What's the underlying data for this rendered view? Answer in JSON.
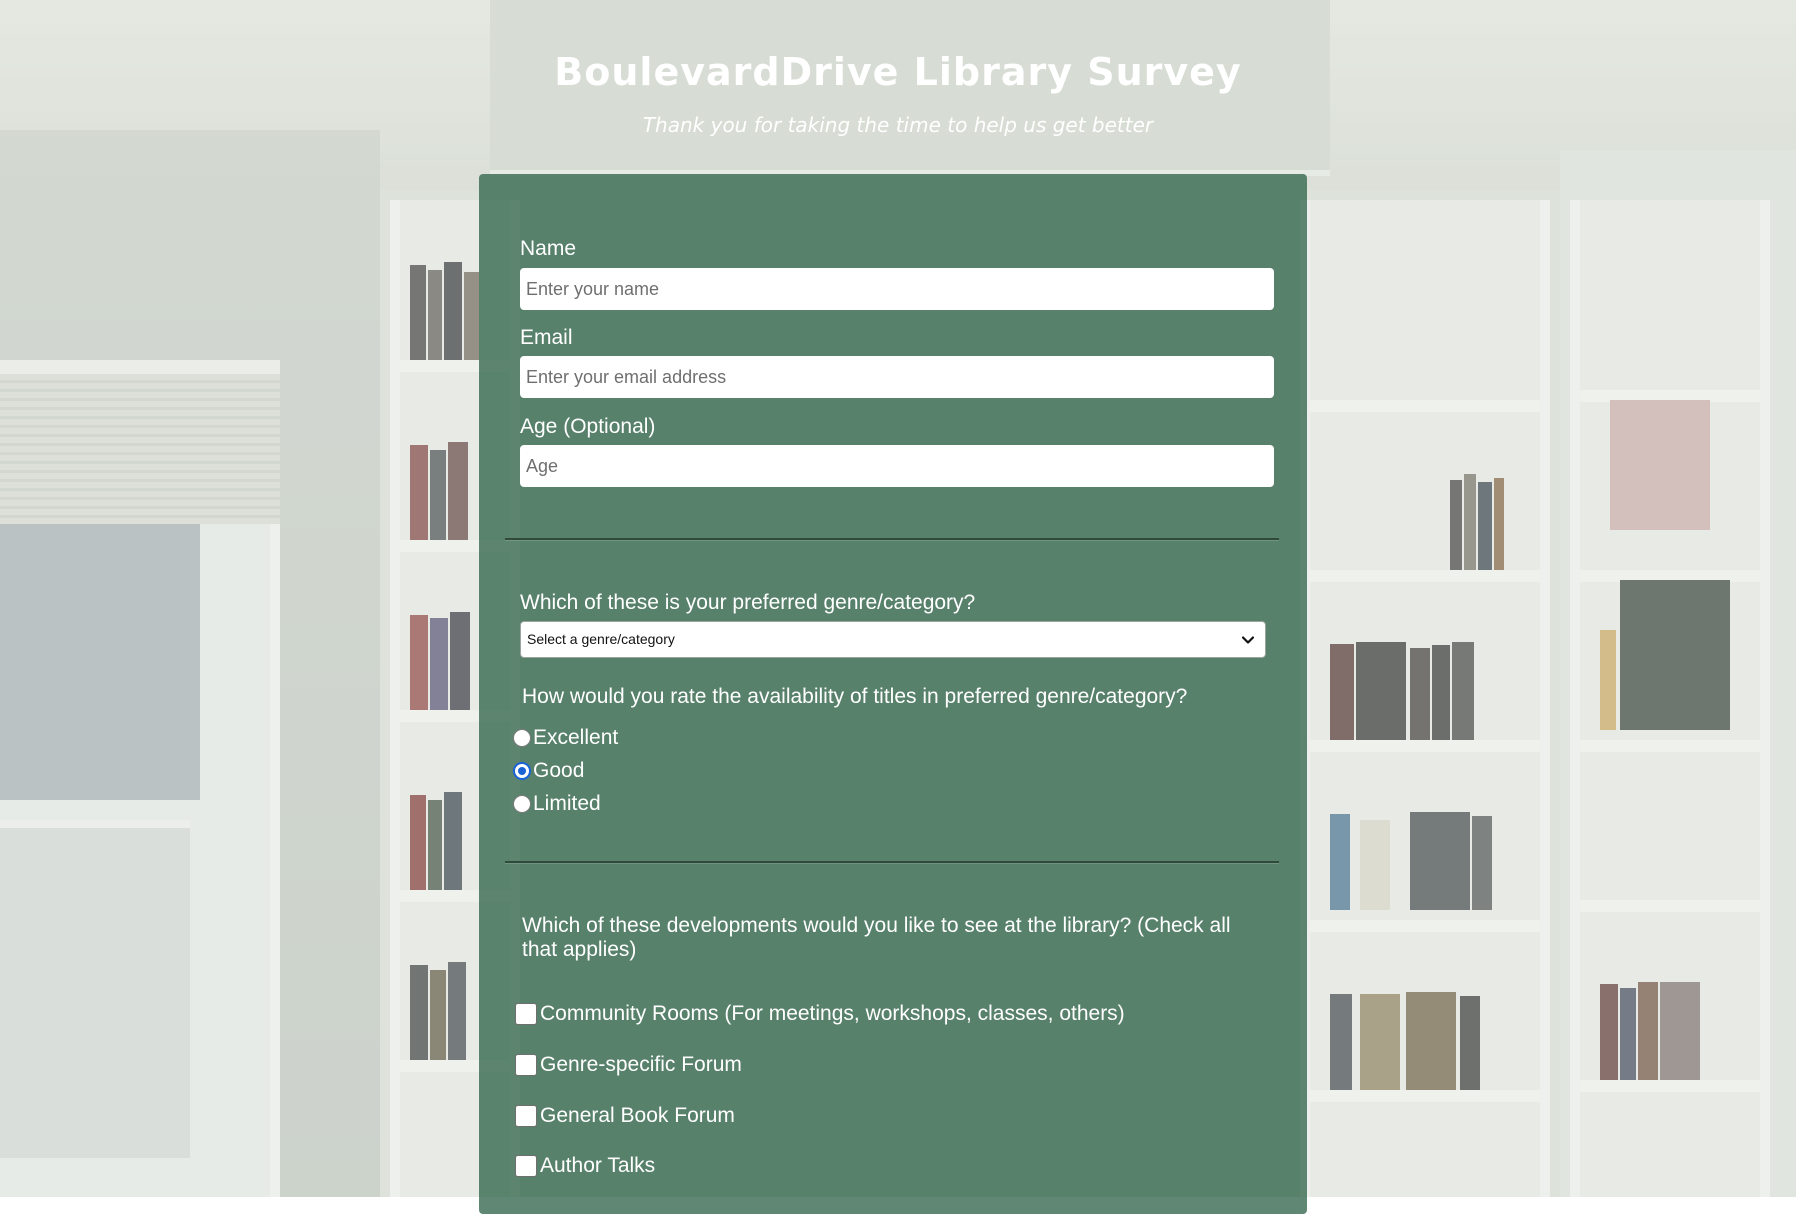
{
  "header": {
    "title": "BoulevardDrive Library Survey",
    "subtitle": "Thank you for taking the time to help us get better"
  },
  "form": {
    "name": {
      "label": "Name",
      "placeholder": "Enter your name",
      "value": ""
    },
    "email": {
      "label": "Email",
      "placeholder": "Enter your email address",
      "value": ""
    },
    "age": {
      "label": "Age (Optional)",
      "placeholder": "Age",
      "value": ""
    },
    "genre": {
      "question": "Which of these is your preferred genre/category?",
      "selected": "Select a genre/category"
    },
    "availability": {
      "question": "How would you rate the availability of titles in preferred genre/category?",
      "options": [
        {
          "label": "Excellent",
          "checked": false
        },
        {
          "label": "Good",
          "checked": true
        },
        {
          "label": "Limited",
          "checked": false
        }
      ]
    },
    "developments": {
      "question": "Which of these developments would you like to see at the library? (Check all that applies)",
      "options": [
        {
          "label": "Community Rooms (For meetings, workshops, classes, others)",
          "checked": false
        },
        {
          "label": "Genre-specific Forum",
          "checked": false
        },
        {
          "label": "General Book Forum",
          "checked": false
        },
        {
          "label": "Author Talks",
          "checked": false
        }
      ]
    }
  },
  "colors": {
    "panel": "#37694f",
    "radio_accent": "#1a63d6",
    "text": "#ffffff"
  },
  "icons": {
    "select_arrow": "chevron-down-icon"
  }
}
